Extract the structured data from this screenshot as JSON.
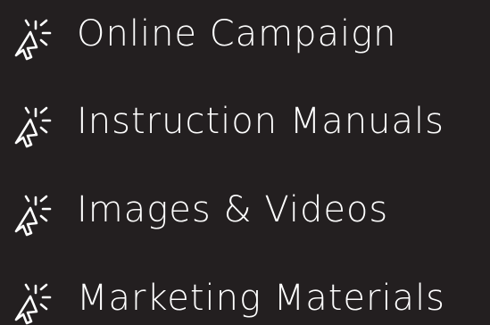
{
  "colors": {
    "background": "#231f20",
    "text": "#ffffff",
    "icon": "#ffffff"
  },
  "items": [
    {
      "label": "Online Campaign",
      "icon": "cursor-click-icon"
    },
    {
      "label": "Instruction Manuals",
      "icon": "cursor-click-icon"
    },
    {
      "label": "Images & Videos",
      "icon": "cursor-click-icon"
    },
    {
      "label": "Marketing Materials",
      "icon": "cursor-click-icon"
    }
  ]
}
